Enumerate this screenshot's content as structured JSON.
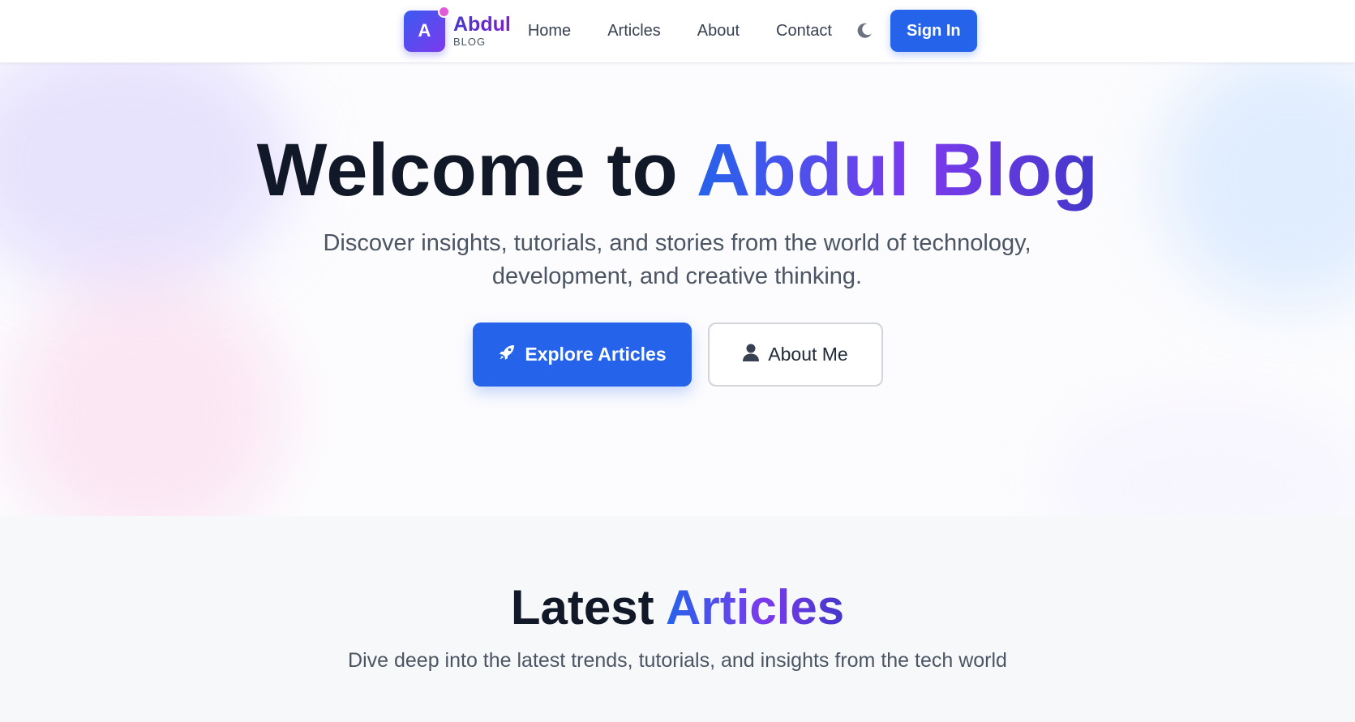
{
  "nav": {
    "logo_letter": "A",
    "logo_title": "Abdul",
    "logo_sub": "BLOG",
    "links": [
      "Home",
      "Articles",
      "About",
      "Contact"
    ],
    "theme_icon": "moon-icon",
    "signin_label": "Sign In"
  },
  "hero": {
    "title_prefix": "Welcome to",
    "title_highlight": "Abdul Blog",
    "subtitle_line1": "Discover insights, tutorials, and stories from the world of technology,",
    "subtitle_line2": "development, and creative thinking.",
    "primary_label": "Explore Articles",
    "primary_icon": "rocket-icon",
    "secondary_label": "About Me",
    "secondary_icon": "user-icon"
  },
  "latest": {
    "title_prefix": "Latest",
    "title_highlight": "Articles",
    "subtitle": "Dive deep into the latest trends, tutorials, and insights from the tech world"
  },
  "colors": {
    "primary": "#2563eb",
    "gradient_start": "#2563eb",
    "gradient_end": "#7c3aed",
    "heading": "#111827",
    "muted": "#4b5563"
  }
}
